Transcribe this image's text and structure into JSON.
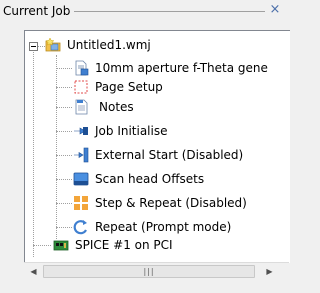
{
  "panel": {
    "title": "Current Job",
    "close_glyph": "×"
  },
  "tree": {
    "root": {
      "label": "Untitled1.wmj",
      "icon": "job-folder-icon",
      "expander": "minus"
    },
    "children": [
      {
        "label": "10mm aperture f-Theta gene",
        "icon": "lens-document-icon"
      },
      {
        "label": "Page Setup",
        "icon": "page-setup-icon"
      },
      {
        "label": "Notes",
        "icon": "notes-icon"
      },
      {
        "label": "Job Initialise",
        "icon": "job-initialise-icon"
      },
      {
        "label": "External Start (Disabled)",
        "icon": "external-start-icon"
      },
      {
        "label": "Scan head Offsets",
        "icon": "scan-head-offsets-icon"
      },
      {
        "label": "Step & Repeat (Disabled)",
        "icon": "step-repeat-icon"
      },
      {
        "label": "Repeat (Prompt mode)",
        "icon": "repeat-icon"
      }
    ],
    "device": {
      "label": "SPICE #1 on PCI",
      "icon": "pci-card-icon"
    }
  },
  "scrollbar": {
    "left_glyph": "◀",
    "right_glyph": "▶",
    "grip": "|||"
  },
  "colors": {
    "tree_lines": "#a0a0a0",
    "border": "#828790",
    "close_icon": "#4a6ea9"
  }
}
